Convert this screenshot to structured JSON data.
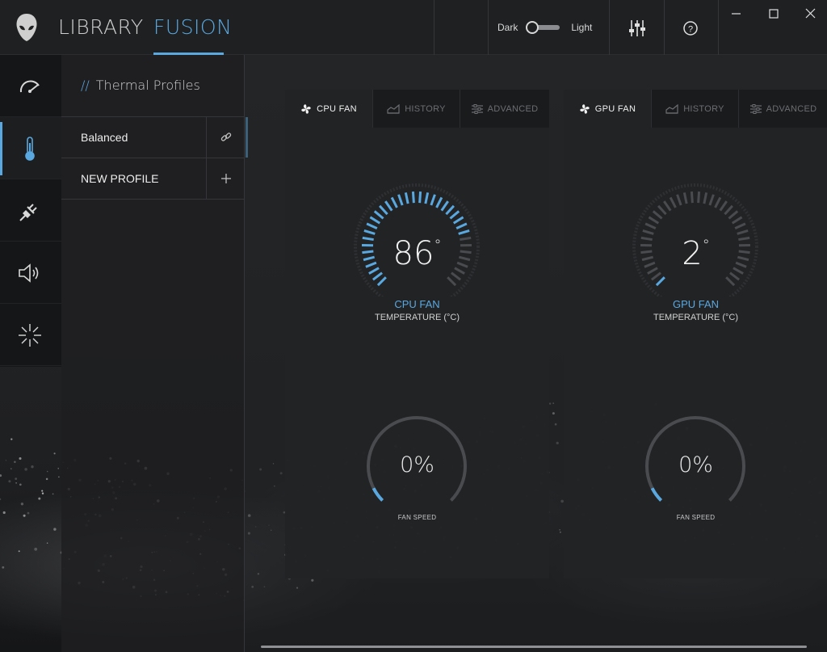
{
  "nav": {
    "library": "LIBRARY",
    "fusion": "FUSION"
  },
  "theme": {
    "dark_label": "Dark",
    "light_label": "Light"
  },
  "colors": {
    "accent": "#5aa8e0",
    "inactive_tick": "#4a4b4f"
  },
  "rail": {
    "items": [
      "performance-gauge-icon",
      "thermometer-icon",
      "power-plug-icon",
      "speaker-icon",
      "lighting-burst-icon"
    ],
    "active": "thermometer-icon"
  },
  "profiles": {
    "title_prefix": "//",
    "title": "Thermal Profiles",
    "items": [
      {
        "label": "Balanced",
        "action_icon": "link-icon"
      },
      {
        "label": "NEW PROFILE",
        "action_icon": "plus-icon"
      }
    ]
  },
  "cards": [
    {
      "tabs": [
        "CPU FAN",
        "HISTORY",
        "ADVANCED"
      ],
      "temperature": "86",
      "degree_symbol": "°",
      "temp_fraction": 0.78,
      "name": "CPU FAN",
      "subtitle": "TEMPERATURE (°C)",
      "fan_speed": "0%",
      "fan_label": "FAN SPEED"
    },
    {
      "tabs": [
        "GPU FAN",
        "HISTORY",
        "ADVANCED"
      ],
      "temperature": "2",
      "degree_symbol": "°",
      "temp_fraction": 0.03,
      "name": "GPU FAN",
      "subtitle": "TEMPERATURE (°C)",
      "fan_speed": "0%",
      "fan_label": "FAN SPEED"
    }
  ]
}
